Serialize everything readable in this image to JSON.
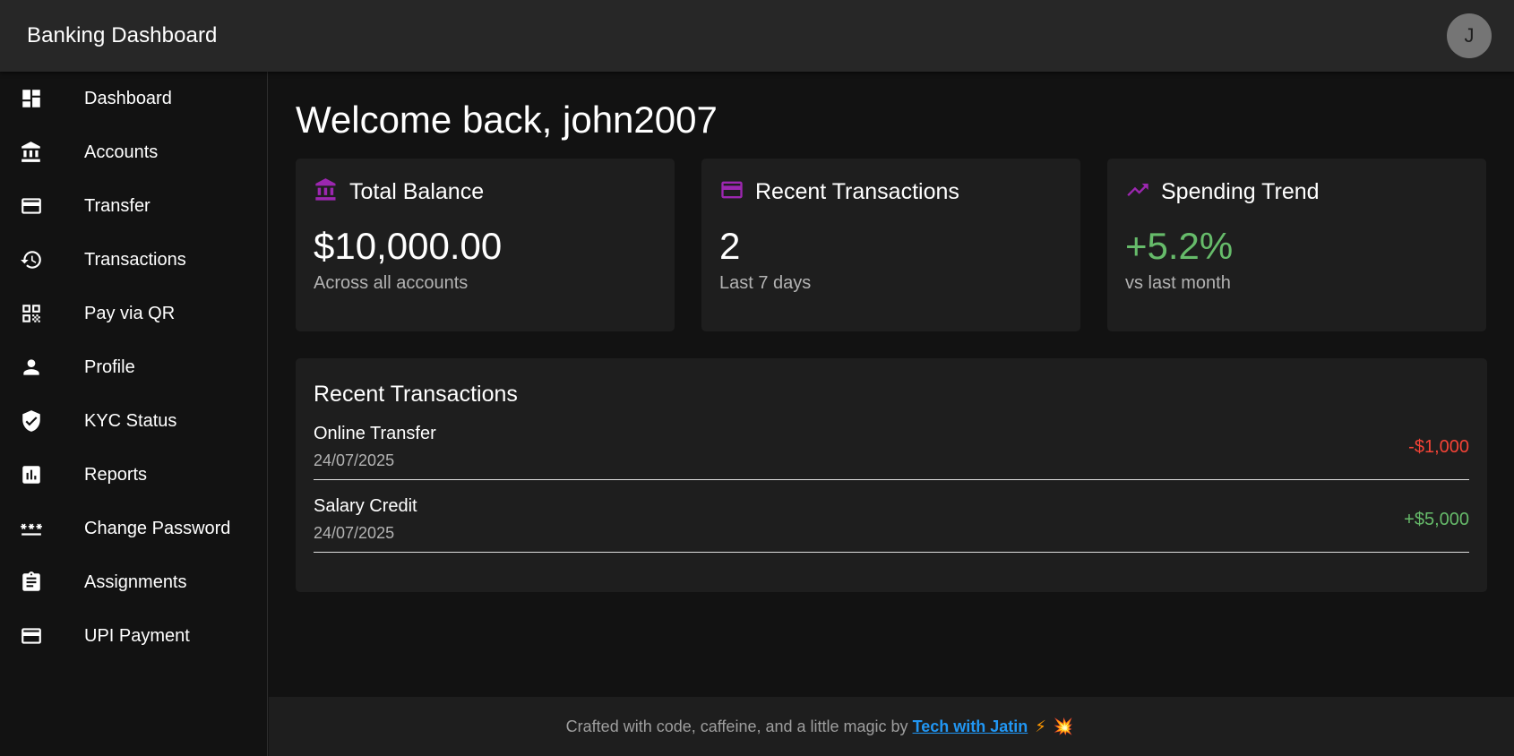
{
  "header": {
    "title": "Banking Dashboard",
    "avatar_initial": "J"
  },
  "sidebar": {
    "items": [
      {
        "label": "Dashboard",
        "icon": "dashboard-icon"
      },
      {
        "label": "Accounts",
        "icon": "bank-icon"
      },
      {
        "label": "Transfer",
        "icon": "credit-card-icon"
      },
      {
        "label": "Transactions",
        "icon": "history-icon"
      },
      {
        "label": "Pay via QR",
        "icon": "qr-code-icon"
      },
      {
        "label": "Profile",
        "icon": "person-icon"
      },
      {
        "label": "KYC Status",
        "icon": "verified-shield-icon"
      },
      {
        "label": "Reports",
        "icon": "bar-chart-icon"
      },
      {
        "label": "Change Password",
        "icon": "password-icon"
      },
      {
        "label": "Assignments",
        "icon": "clipboard-icon"
      },
      {
        "label": "UPI Payment",
        "icon": "credit-card-icon"
      }
    ]
  },
  "main": {
    "welcome": "Welcome back, john2007",
    "cards": [
      {
        "title": "Total Balance",
        "icon": "bank-icon",
        "value": "$10,000.00",
        "sub": "Across all accounts"
      },
      {
        "title": "Recent Transactions",
        "icon": "credit-card-icon",
        "value": "2",
        "sub": "Last 7 days"
      },
      {
        "title": "Spending Trend",
        "icon": "trending-up-icon",
        "value": "+5.2%",
        "sub": "vs last month"
      }
    ],
    "transactions_panel": {
      "title": "Recent Transactions",
      "rows": [
        {
          "name": "Online Transfer",
          "date": "24/07/2025",
          "amount": "-$1,000"
        },
        {
          "name": "Salary Credit",
          "date": "24/07/2025",
          "amount": "+$5,000"
        }
      ]
    }
  },
  "footer": {
    "text": "Crafted with code, caffeine, and a little magic by",
    "link": "Tech with Jatin",
    "emoji1": "⚡",
    "emoji2": "💥"
  },
  "colors": {
    "accent": "#9c27b0",
    "positive": "#66bb6a",
    "negative": "#f44336",
    "link": "#2196f3"
  }
}
